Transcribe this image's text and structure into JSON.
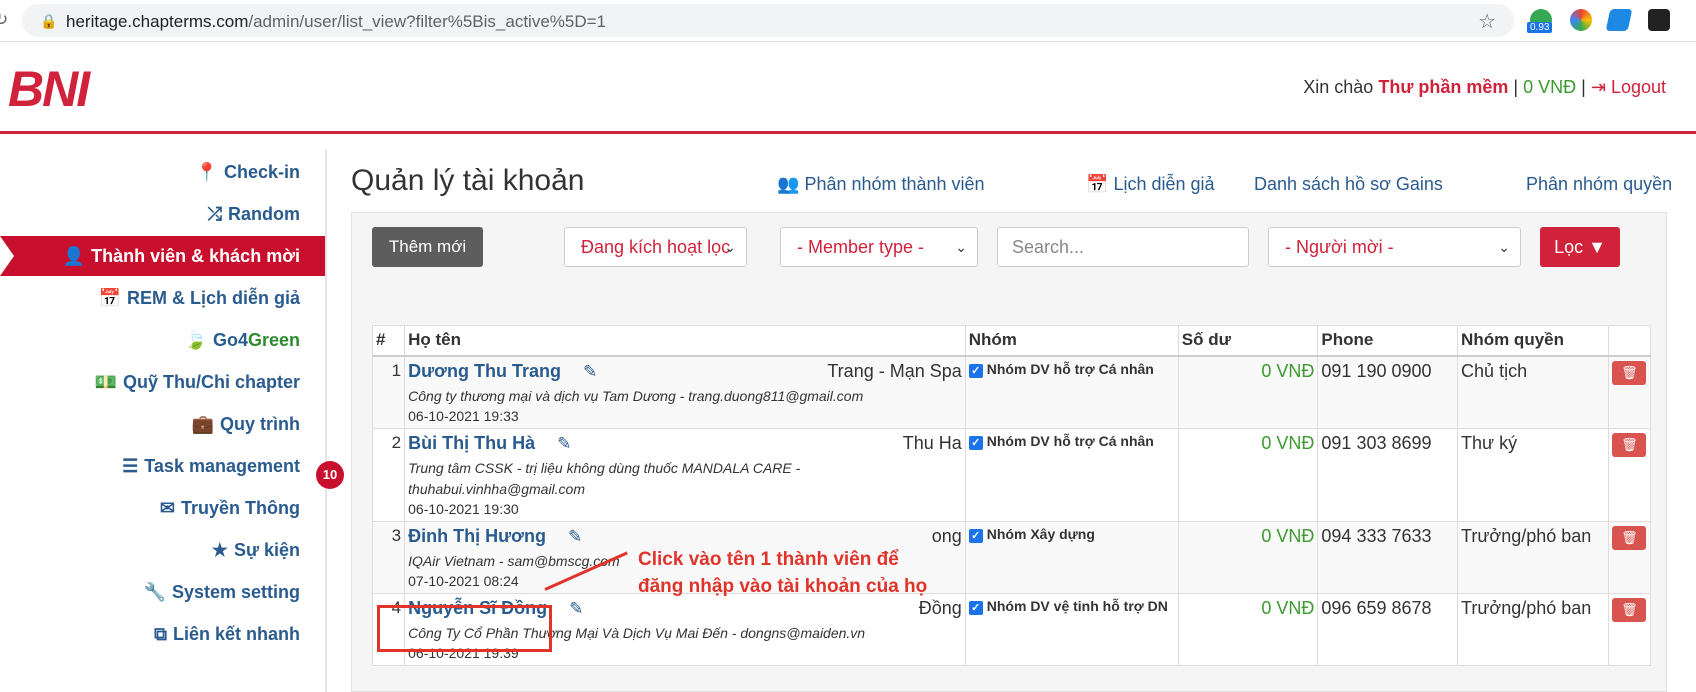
{
  "browser": {
    "url_host": "heritage.chapterms.com",
    "url_path": "/admin/user/list_view?filter%5Bis_active%5D=1",
    "ext_badge": "0.93"
  },
  "header": {
    "logo": "BNI",
    "greeting": "Xin chào",
    "user_name": "Thư phần mềm",
    "balance": "0 VNĐ",
    "separator": "|",
    "logout": "Logout"
  },
  "sidebar": {
    "items": [
      {
        "label": "Check-in"
      },
      {
        "label": "Random"
      },
      {
        "label": "Thành viên & khách mời"
      },
      {
        "label": "REM & Lịch diễn giả"
      },
      {
        "label_a": "Go4",
        "label_b": "Green"
      },
      {
        "label": "Quỹ Thu/Chi chapter"
      },
      {
        "label": "Quy trình"
      },
      {
        "label": "Task management"
      },
      {
        "label": "Truyền Thông"
      },
      {
        "label": "Sự kiện"
      },
      {
        "label": "System setting"
      },
      {
        "label": "Liên kết nhanh"
      }
    ],
    "notification_count": "10"
  },
  "main": {
    "title": "Quản lý tài khoản",
    "links": [
      "Phân nhóm thành viên",
      "Lịch diễn giả",
      "Danh sách hồ sơ Gains",
      "Phân nhóm quyền"
    ],
    "add_button": "Thêm mới",
    "filter_status": "Đang kích hoạt lọc",
    "filter_member_type": "- Member type -",
    "search_placeholder": "Search...",
    "filter_inviter": "- Người mời -",
    "filter_button": "Lọc"
  },
  "table": {
    "headers": [
      "#",
      "Họ tên",
      "Nhóm",
      "Số dư",
      "Phone",
      "Nhóm quyền"
    ],
    "rows": [
      {
        "idx": "1",
        "name": "Dương Thu Trang",
        "short": "Trang - Mạn Spa",
        "company": "Công ty thương mại và dịch vụ Tam Dương - trang.duong811@gmail.com",
        "date": "06-10-2021 19:33",
        "group": "Nhóm DV hỗ trợ Cá nhân",
        "balance": "0 VNĐ",
        "phone": "091 190 0900",
        "role": "Chủ tịch"
      },
      {
        "idx": "2",
        "name": "Bùi Thị Thu Hà",
        "short": "Thu Ha",
        "company": "Trung tâm CSSK - trị liệu không dùng thuốc MANDALA CARE - thuhabui.vinhha@gmail.com",
        "date": "06-10-2021 19:30",
        "group": "Nhóm DV hỗ trợ Cá nhân",
        "balance": "0 VNĐ",
        "phone": "091 303 8699",
        "role": "Thư ký"
      },
      {
        "idx": "3",
        "name": "Đinh Thị Hương",
        "short": "ong",
        "company": "IQAir Vietnam - sam@bmscg.com",
        "date": "07-10-2021 08:24",
        "group": "Nhóm Xây dựng",
        "balance": "0 VNĐ",
        "phone": "094 333 7633",
        "role": "Trưởng/phó ban"
      },
      {
        "idx": "4",
        "name": "Nguyễn Sĩ Đồng",
        "short": "Đồng",
        "company": "Công Ty Cổ Phần Thương Mại Và Dịch Vụ Mai Đến - dongns@maiden.vn",
        "date": "06-10-2021 19:39",
        "group": "Nhóm DV vệ tinh hỗ trợ DN",
        "balance": "0 VNĐ",
        "phone": "096 659 8678",
        "role": "Trưởng/phó ban"
      }
    ]
  },
  "annotation": {
    "line1": "Click vào tên 1 thành viên để",
    "line2": "đăng nhập vào tài khoản của họ"
  }
}
